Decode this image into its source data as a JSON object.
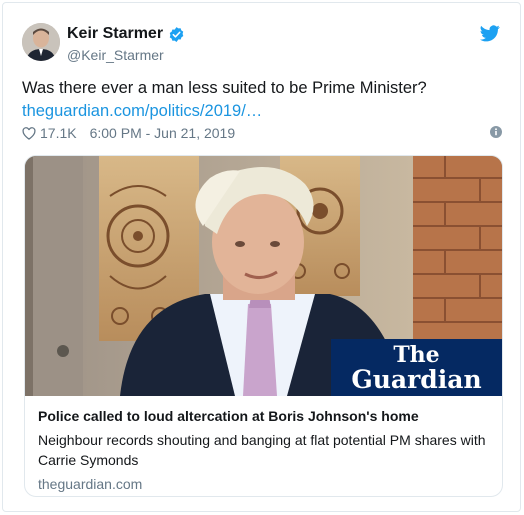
{
  "user": {
    "name": "Keir Starmer",
    "handle": "@Keir_Starmer"
  },
  "tweet": {
    "text": "Was there ever a man less suited to be Prime Minister?",
    "link_text": "theguardian.com/politics/2019/…"
  },
  "meta": {
    "likes": "17.1K",
    "timestamp": "6:00 PM - Jun 21, 2019"
  },
  "card": {
    "logo_line1": "The",
    "logo_line2": "Guardian",
    "title": "Police called to loud altercation at Boris Johnson's home",
    "description": "Neighbour records shouting and banging at flat potential PM shares with Carrie Symonds",
    "domain": "theguardian.com"
  },
  "colors": {
    "link": "#1b95e0",
    "muted": "#657786",
    "verified": "#1da1f2",
    "guardian": "#052962"
  },
  "icons": [
    "verified-badge-icon",
    "twitter-bird-icon",
    "heart-icon",
    "info-icon"
  ]
}
